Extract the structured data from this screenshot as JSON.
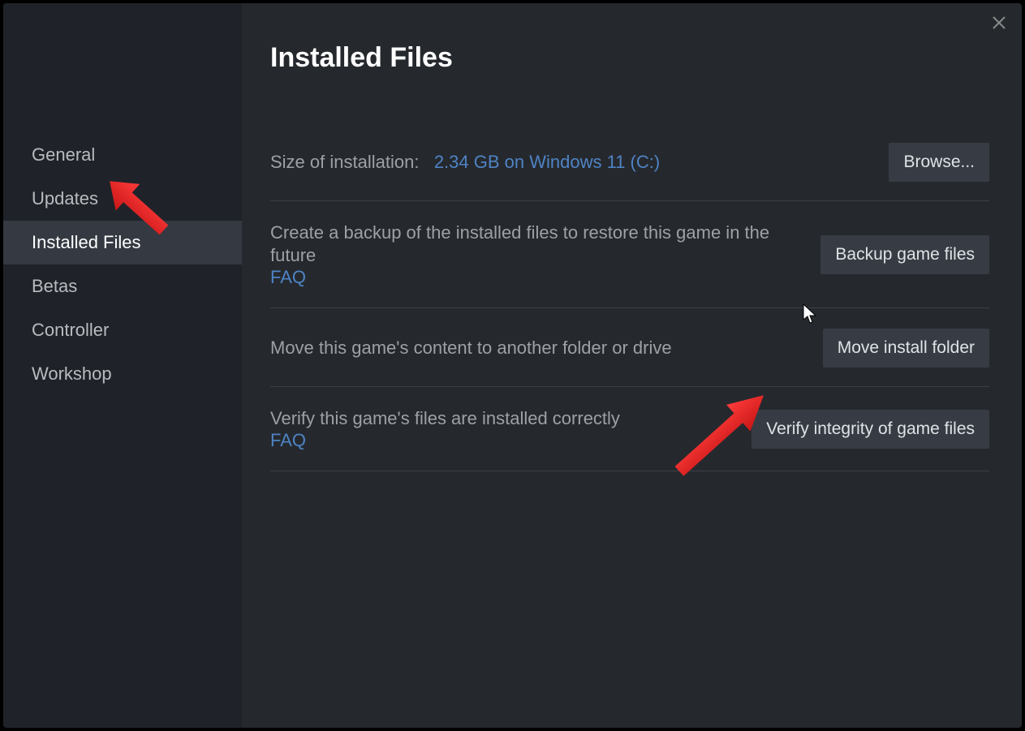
{
  "sidebar": {
    "items": [
      {
        "label": "General"
      },
      {
        "label": "Updates"
      },
      {
        "label": "Installed Files"
      },
      {
        "label": "Betas"
      },
      {
        "label": "Controller"
      },
      {
        "label": "Workshop"
      }
    ],
    "active_index": 2
  },
  "main": {
    "title": "Installed Files",
    "size_row": {
      "label": "Size of installation:",
      "value": "2.34 GB on Windows 11 (C:)",
      "button": "Browse..."
    },
    "backup_row": {
      "text": "Create a backup of the installed files to restore this game in the future",
      "faq": "FAQ",
      "button": "Backup game files"
    },
    "move_row": {
      "text": "Move this game's content to another folder or drive",
      "button": "Move install folder"
    },
    "verify_row": {
      "text": "Verify this game's files are installed correctly",
      "faq": "FAQ",
      "button": "Verify integrity of game files"
    }
  },
  "annotations": {
    "arrow_color": "#e63b3b"
  }
}
